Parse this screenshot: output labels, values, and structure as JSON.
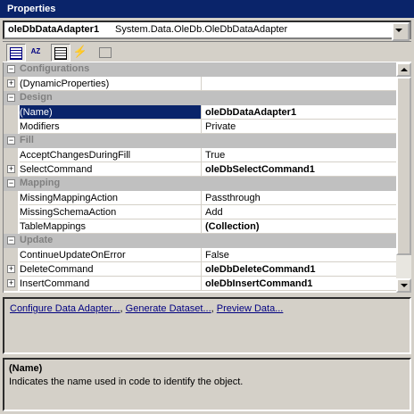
{
  "window": {
    "title": "Properties"
  },
  "object_selector": {
    "name": "oleDbDataAdapter1",
    "type": "System.Data.OleDb.OleDbDataAdapter"
  },
  "toolbar": {
    "buttons": [
      {
        "icon": "categorized-icon",
        "pressed": true
      },
      {
        "icon": "alphabetical-icon",
        "glyph": "AZ",
        "pressed": false
      },
      {
        "icon": "properties-icon",
        "pressed": true
      },
      {
        "icon": "events-icon",
        "glyph": "⚡",
        "pressed": false
      },
      {
        "icon": "property-pages-icon",
        "pressed": false
      }
    ]
  },
  "grid": {
    "rows": [
      {
        "kind": "category",
        "label": "Configurations"
      },
      {
        "kind": "property",
        "name": "(DynamicProperties)",
        "value": "",
        "expandable": true
      },
      {
        "kind": "category",
        "label": "Design"
      },
      {
        "kind": "property",
        "name": "(Name)",
        "value": "oleDbDataAdapter1",
        "bold": true,
        "selected": true
      },
      {
        "kind": "property",
        "name": "Modifiers",
        "value": "Private"
      },
      {
        "kind": "category",
        "label": "Fill"
      },
      {
        "kind": "property",
        "name": "AcceptChangesDuringFill",
        "value": "True"
      },
      {
        "kind": "property",
        "name": "SelectCommand",
        "value": "oleDbSelectCommand1",
        "bold": true,
        "expandable": true
      },
      {
        "kind": "category",
        "label": "Mapping"
      },
      {
        "kind": "property",
        "name": "MissingMappingAction",
        "value": "Passthrough"
      },
      {
        "kind": "property",
        "name": "MissingSchemaAction",
        "value": "Add"
      },
      {
        "kind": "property",
        "name": "TableMappings",
        "value": "(Collection)",
        "bold": true
      },
      {
        "kind": "category",
        "label": "Update"
      },
      {
        "kind": "property",
        "name": "ContinueUpdateOnError",
        "value": "False"
      },
      {
        "kind": "property",
        "name": "DeleteCommand",
        "value": "oleDbDeleteCommand1",
        "bold": true,
        "expandable": true
      },
      {
        "kind": "property",
        "name": "InsertCommand",
        "value": "oleDbInsertCommand1",
        "bold": true,
        "expandable": true
      }
    ]
  },
  "commands": {
    "links": [
      "Configure Data Adapter...",
      "Generate Dataset...",
      "Preview Data..."
    ],
    "separator": ", "
  },
  "description": {
    "title": "(Name)",
    "text": "Indicates the name used in code to identify the object."
  }
}
